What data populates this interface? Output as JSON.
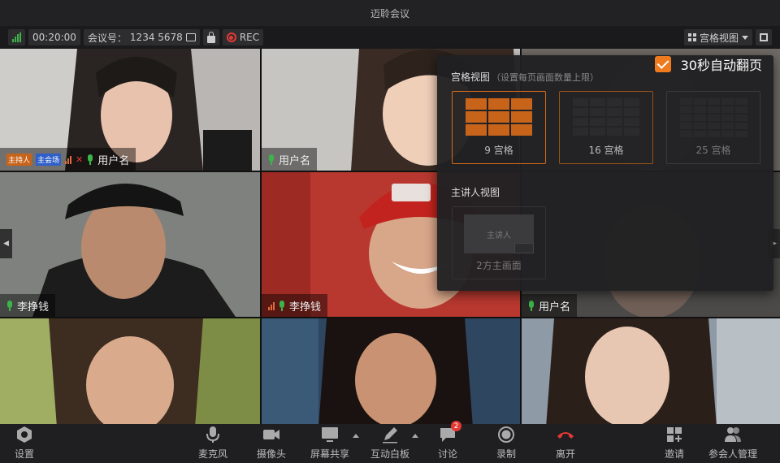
{
  "window": {
    "title": "迈聆会议"
  },
  "infobar": {
    "duration": "00:20:00",
    "meeting_id_label": "会议号：",
    "meeting_id": "1234 5678",
    "rec_label": "REC",
    "view_mode_label": "宫格视图"
  },
  "tiles": [
    {
      "host_badge": "主持人",
      "main_badge": "主会场",
      "name": "用户名"
    },
    {
      "name": "用户名"
    },
    {
      "name": ""
    },
    {
      "name": "李挣钱"
    },
    {
      "name": "李挣钱"
    },
    {
      "name": "用户名"
    },
    {
      "name": ""
    },
    {
      "name": ""
    },
    {
      "name": ""
    }
  ],
  "popup": {
    "auto_flip_label": "30秒自动翻页",
    "auto_flip_checked": true,
    "grid_section_title": "宫格视图",
    "grid_section_hint": "（设置每页画面数量上限）",
    "grid_options": [
      {
        "label": "9 宫格",
        "selected": true
      },
      {
        "label": "16 宫格",
        "selected": false
      },
      {
        "label": "25 宫格",
        "selected": false
      }
    ],
    "speaker_section_title": "主讲人视图",
    "speaker_main_text": "主讲人",
    "speaker_option_label": "2方主画面"
  },
  "toolbar": {
    "settings": "设置",
    "mic": "麦克风",
    "camera": "摄像头",
    "screen_share": "屏幕共享",
    "whiteboard": "互动白板",
    "chat": "讨论",
    "chat_unread": "2",
    "record": "录制",
    "leave": "离开",
    "invite": "邀请",
    "participants": "参会人管理"
  },
  "colors": {
    "accent": "#f07b1e",
    "leave": "#e53935",
    "mic_active": "#3cb44a"
  }
}
